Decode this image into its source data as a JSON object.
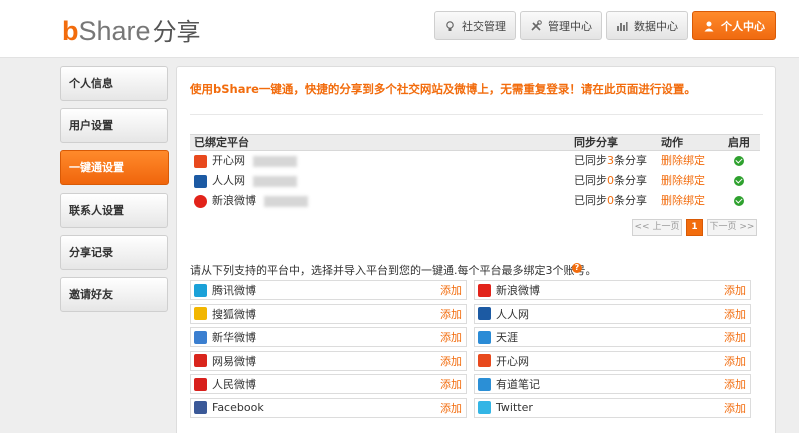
{
  "header": {
    "logo_b": "b",
    "logo_share": "Share",
    "logo_cn": "分享",
    "nav": [
      {
        "label": "社交管理",
        "icon": "bulb-icon"
      },
      {
        "label": "管理中心",
        "icon": "tools-icon"
      },
      {
        "label": "数据中心",
        "icon": "chart-icon"
      },
      {
        "label": "个人中心",
        "icon": "user-icon"
      }
    ]
  },
  "sidebar": {
    "items": [
      {
        "label": "个人信息"
      },
      {
        "label": "用户设置"
      },
      {
        "label": "一键通设置"
      },
      {
        "label": "联系人设置"
      },
      {
        "label": "分享记录"
      },
      {
        "label": "邀请好友"
      }
    ]
  },
  "main": {
    "notice": "使用bShare一键通，快捷的分享到多个社交网站及微博上，无需重复登录！请在此页面进行设置。",
    "bound_table": {
      "headers": {
        "platform": "已绑定平台",
        "sync": "同步分享",
        "action": "动作",
        "enabled": "启用"
      },
      "rows": [
        {
          "platform": "开心网",
          "icon_color": "#e8491d",
          "sync_prefix": "已同步",
          "sync_count": "3",
          "sync_suffix": "条分享",
          "action": "删除绑定"
        },
        {
          "platform": "人人网",
          "icon_color": "#1c5aa3",
          "sync_prefix": "已同步",
          "sync_count": "0",
          "sync_suffix": "条分享",
          "action": "删除绑定"
        },
        {
          "platform": "新浪微博",
          "icon_color": "#e2231a",
          "sync_prefix": "已同步",
          "sync_count": "0",
          "sync_suffix": "条分享",
          "action": "删除绑定"
        }
      ]
    },
    "pager": {
      "prev": "<< 上一页",
      "current": "1",
      "next": "下一页 >>"
    },
    "instructions": "请从下列支持的平台中，选择并导入平台到您的一键通.每个平台最多绑定3个账号。",
    "help": "?",
    "available": [
      {
        "name": "腾讯微博",
        "add": "添加",
        "icon_color": "#1ba1d8"
      },
      {
        "name": "新浪微博",
        "add": "添加",
        "icon_color": "#e2231a"
      },
      {
        "name": "搜狐微博",
        "add": "添加",
        "icon_color": "#f2b600"
      },
      {
        "name": "人人网",
        "add": "添加",
        "icon_color": "#1c5aa3"
      },
      {
        "name": "新华微博",
        "add": "添加",
        "icon_color": "#3b7fd0"
      },
      {
        "name": "天涯",
        "add": "添加",
        "icon_color": "#2a8bd6"
      },
      {
        "name": "网易微博",
        "add": "添加",
        "icon_color": "#d9251c"
      },
      {
        "name": "开心网",
        "add": "添加",
        "icon_color": "#e8491d"
      },
      {
        "name": "人民微博",
        "add": "添加",
        "icon_color": "#d8201c"
      },
      {
        "name": "有道笔记",
        "add": "添加",
        "icon_color": "#2b8fd6"
      },
      {
        "name": "Facebook",
        "add": "添加",
        "icon_color": "#3b5998"
      },
      {
        "name": "Twitter",
        "add": "添加",
        "icon_color": "#33b5e5"
      }
    ]
  },
  "colors": {
    "accent": "#f26c0d",
    "check": "#2fa12f"
  }
}
